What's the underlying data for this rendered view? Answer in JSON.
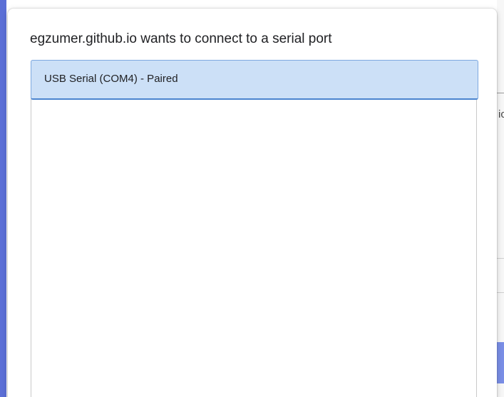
{
  "dialog": {
    "title": "egzumer.github.io wants to connect to a serial port",
    "devices": [
      {
        "label": "USB Serial (COM4) - Paired",
        "selected": true
      }
    ]
  },
  "background": {
    "text_fragment": "ic"
  },
  "colors": {
    "accent": "#5b6fd6",
    "selection_fill": "#cce0f7",
    "selection_border": "#4a84cf",
    "side_block": "#7a8ee6"
  }
}
